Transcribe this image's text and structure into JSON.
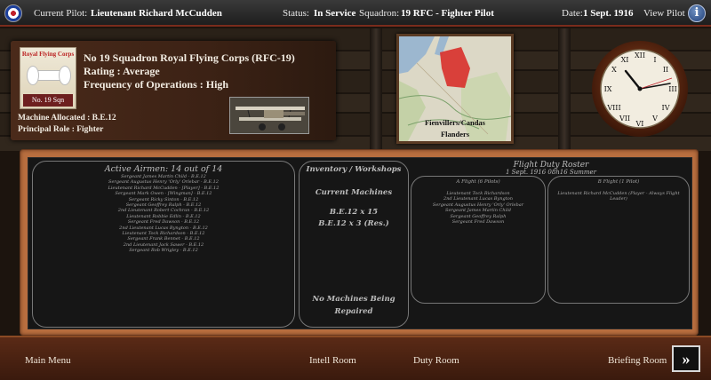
{
  "topbar": {
    "pilot_label": "Current Pilot:",
    "pilot_name": "Lieutenant Richard McCudden",
    "status_label": "Status:",
    "status_value": "In Service",
    "squadron_label": "Squadron:",
    "squadron_value": "19 RFC - Fighter Pilot",
    "date_label": "Date:",
    "date_value": "1 Sept. 1916",
    "view_pilot": "View Pilot"
  },
  "squadron": {
    "badge_title": "Royal Flying Corps",
    "badge_number": "No. 19 Sqn",
    "name": "No 19 Squadron Royal Flying Corps (RFC-19)",
    "rating": "Rating : Average",
    "frequency": "Frequency of Operations : High",
    "machine": "Machine Allocated : B.E.12",
    "role": "Principal Role : Fighter"
  },
  "map": {
    "line1": "Fienvillers/Candas",
    "line2": "Flanders"
  },
  "board": {
    "airmen_header": "Active Airmen: 14 out of 14",
    "airmen": [
      "Sergeant James Martin Child  -  B.E.12",
      "Sergeant Augustus Henry 'Orly' Orlebar  -  B.E.12",
      "Lieutenant Richard McCudden  -  [Player]  -  B.E.12",
      "Sergeant Mark Owen  -  [Wingman]  -  B.E.12",
      "Sergeant Ricky Sinton  -  B.E.12",
      "Sergeant Geoffrey Ralph  -  B.E.12",
      "2nd Lieutenant Robert Cochran  -  B.E.12",
      "Lieutenant Robbie Edlin  -  B.E.12",
      "Sergeant Fred Dawson  -  B.E.12",
      "2nd Lieutenant Lucas Byngton  -  B.E.12",
      "Lieutenant Tock Richardson  -  B.E.12",
      "Sergeant Frank Bennet  -  B.E.12",
      "2nd Lieutenant Jack Sawer  -  B.E.12",
      "Sergeant Rob Wrigley  -  B.E.12"
    ],
    "inventory_header": "Inventory / Workshops",
    "current_machines": "Current Machines",
    "machines": [
      "B.E.12 x 15",
      "B.E.12 x 3 (Res.)"
    ],
    "repair_line1": "No Machines Being",
    "repair_line2": "Repaired",
    "roster_title": "Flight Duty Roster",
    "roster_date": "1 Sept. 1916 08h16 Summer",
    "a_flight_header": "A Flight  (6 Pilots)",
    "a_flight": [
      "Lieutenant Tock Richardson",
      "2nd Lieutenant Lucas Byngton",
      "Sergeant Augustus Henry 'Orly' Orlebar",
      "Sergeant James Martin Child",
      "Sergeant Geoffrey Ralph",
      "Sergeant Fred Dawson"
    ],
    "b_flight_header": "B Flight  (1 Pilot)",
    "b_flight": [
      "Lieutenant Richard McCudden (Player - Always Flight Leader)"
    ]
  },
  "nav": {
    "main_menu": "Main Menu",
    "intell_room": "Intell Room",
    "duty_room": "Duty Room",
    "briefing_room": "Briefing Room",
    "next_symbol": "»"
  },
  "colors": {
    "accent_red": "#c0202a",
    "board_frame": "#b86e3f",
    "chalk": "#bdbdbd"
  }
}
